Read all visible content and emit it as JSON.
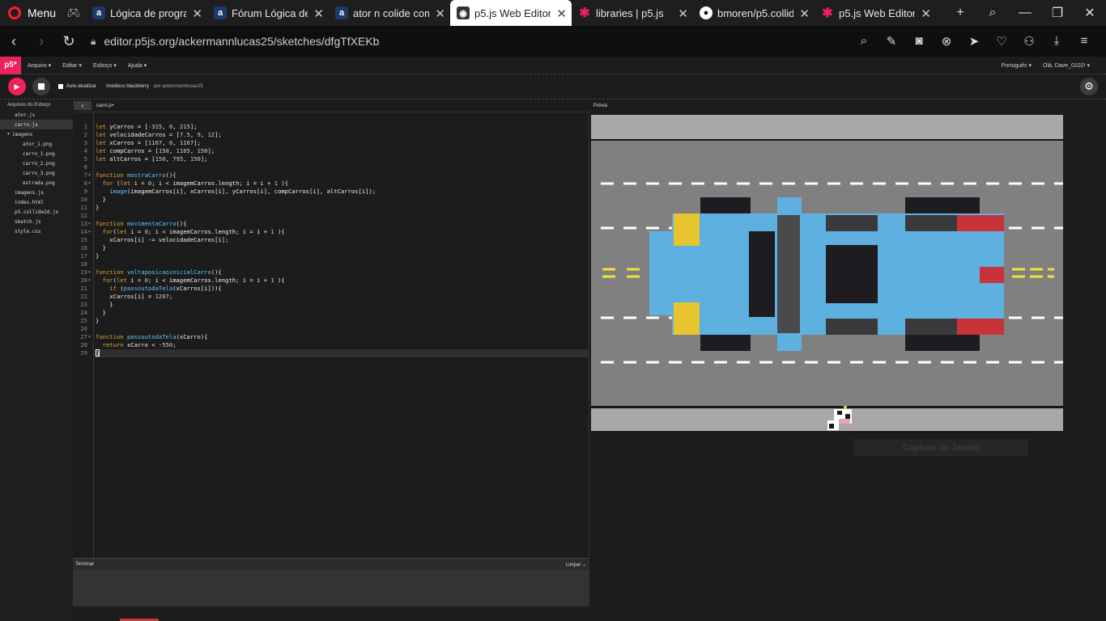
{
  "browser": {
    "menu_label": "Menu",
    "tabs": [
      {
        "title": "Lógica de program",
        "favicon": "alura-icon",
        "active": false
      },
      {
        "title": "Fórum Lógica de p",
        "favicon": "alura-icon",
        "active": false
      },
      {
        "title": "ator n colide com",
        "favicon": "alura-icon",
        "active": false
      },
      {
        "title": "p5.js Web Editor | ",
        "favicon": "p5-icon",
        "active": true
      },
      {
        "title": "libraries | p5.js",
        "favicon": "p5-star-icon",
        "active": false
      },
      {
        "title": "bmoren/p5.collide",
        "favicon": "github-icon",
        "active": false
      },
      {
        "title": "p5.js Web Editor | ",
        "favicon": "p5-star-icon",
        "active": false
      }
    ],
    "url": "editor.p5js.org/ackermannlucas25/sketches/dfgTfXEKb"
  },
  "p5nav": {
    "logo": "p5*",
    "menus": [
      "Arquivo ▾",
      "Editar ▾",
      "Esboço ▾",
      "Ajuda ▾"
    ],
    "language": "Português ▾",
    "user": "Olá, Dave_0102! ▾"
  },
  "toolbar": {
    "autorefresh_label": "Auto-atualizar",
    "sketch_name": "Insidious blackberry",
    "by_label": "por ackermannlucas25"
  },
  "sidebar": {
    "header": "Arquivos do Esboço",
    "files": [
      {
        "name": "ator.js",
        "kind": "file",
        "selected": false
      },
      {
        "name": "carro.js",
        "kind": "file",
        "selected": true
      },
      {
        "name": "imagens",
        "kind": "folder",
        "selected": false
      },
      {
        "name": "ator_1.png",
        "kind": "sub",
        "selected": false
      },
      {
        "name": "carro_1.png",
        "kind": "sub",
        "selected": false
      },
      {
        "name": "carro_2.png",
        "kind": "sub",
        "selected": false
      },
      {
        "name": "carro_3.png",
        "kind": "sub",
        "selected": false
      },
      {
        "name": "estrada.png",
        "kind": "sub",
        "selected": false
      },
      {
        "name": "imagens.js",
        "kind": "file",
        "selected": false
      },
      {
        "name": "index.html",
        "kind": "file",
        "selected": false
      },
      {
        "name": "p5.collide2d.js",
        "kind": "file",
        "selected": false
      },
      {
        "name": "sketch.js",
        "kind": "file",
        "selected": false
      },
      {
        "name": "style.css",
        "kind": "file",
        "selected": false
      }
    ]
  },
  "editor": {
    "file_tab": "carro.js•",
    "current_line": 29,
    "lines": [
      "let yCarros = [-315, 0, 215];",
      "let velocidadeCarros = [7.5, 9, 12];",
      "let xCarros = [1167, 0, 1167];",
      "let compCarros = [150, 1165, 150];",
      "let altCarros = [150, 795, 150];",
      "",
      "function mostraCarro(){",
      "  for (let i = 0; i < imagemCarros.length; i = i + 1 ){",
      "    image(imagemCarros[i], xCarros[i], yCarros[i], compCarros[i], altCarros[i]);",
      "  }",
      "}",
      "",
      "function movimentaCarro(){",
      "  for(let i = 0; i < imagemCarros.length; i = i + 1 ){",
      "    xCarros[i] -= velocidadeCarros[i];",
      "  }",
      "}",
      "",
      "function voltaposicaoinicialCarro(){",
      "  for(let i = 0; i < imagemCarros.length; i = i + 1 ){",
      "    if (passoutodaTela(xCarros[i])){",
      "    xCarros[i] = 1267;",
      "    }",
      "  }",
      "}",
      "",
      "function passoutodaTela(xCarro){",
      "  return xCarro < -550;",
      "}"
    ],
    "fold_lines": [
      7,
      8,
      13,
      14,
      19,
      20,
      27
    ]
  },
  "console": {
    "title": "Terminal",
    "clear_label": "Limpar"
  },
  "preview": {
    "title": "Prévia",
    "capture_label": "Captura de Janela"
  }
}
